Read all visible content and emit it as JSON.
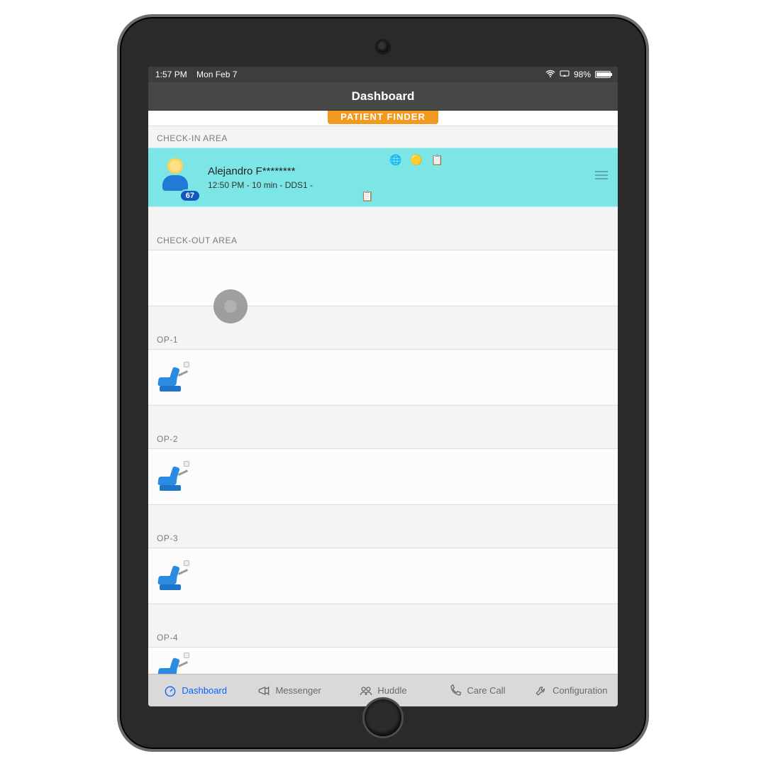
{
  "status": {
    "time": "1:57 PM",
    "date": "Mon Feb 7",
    "battery_pct": "98%",
    "battery_fill_pct": 98
  },
  "nav": {
    "title": "Dashboard"
  },
  "finder": {
    "label": "PATIENT FINDER"
  },
  "sections": {
    "checkin": "CHECK-IN AREA",
    "checkout": "CHECK-OUT AREA",
    "op1": "OP-1",
    "op2": "OP-2",
    "op3": "OP-3",
    "op4": "OP-4"
  },
  "patient": {
    "name": "Alejandro F********",
    "detail": "12:50 PM - 10 min - DDS1 -",
    "badge": "67",
    "icons": "🌐 🟡 📋",
    "clip": "📋"
  },
  "tabs": {
    "dashboard": "Dashboard",
    "messenger": "Messenger",
    "huddle": "Huddle",
    "carecall": "Care Call",
    "configuration": "Configuration"
  }
}
